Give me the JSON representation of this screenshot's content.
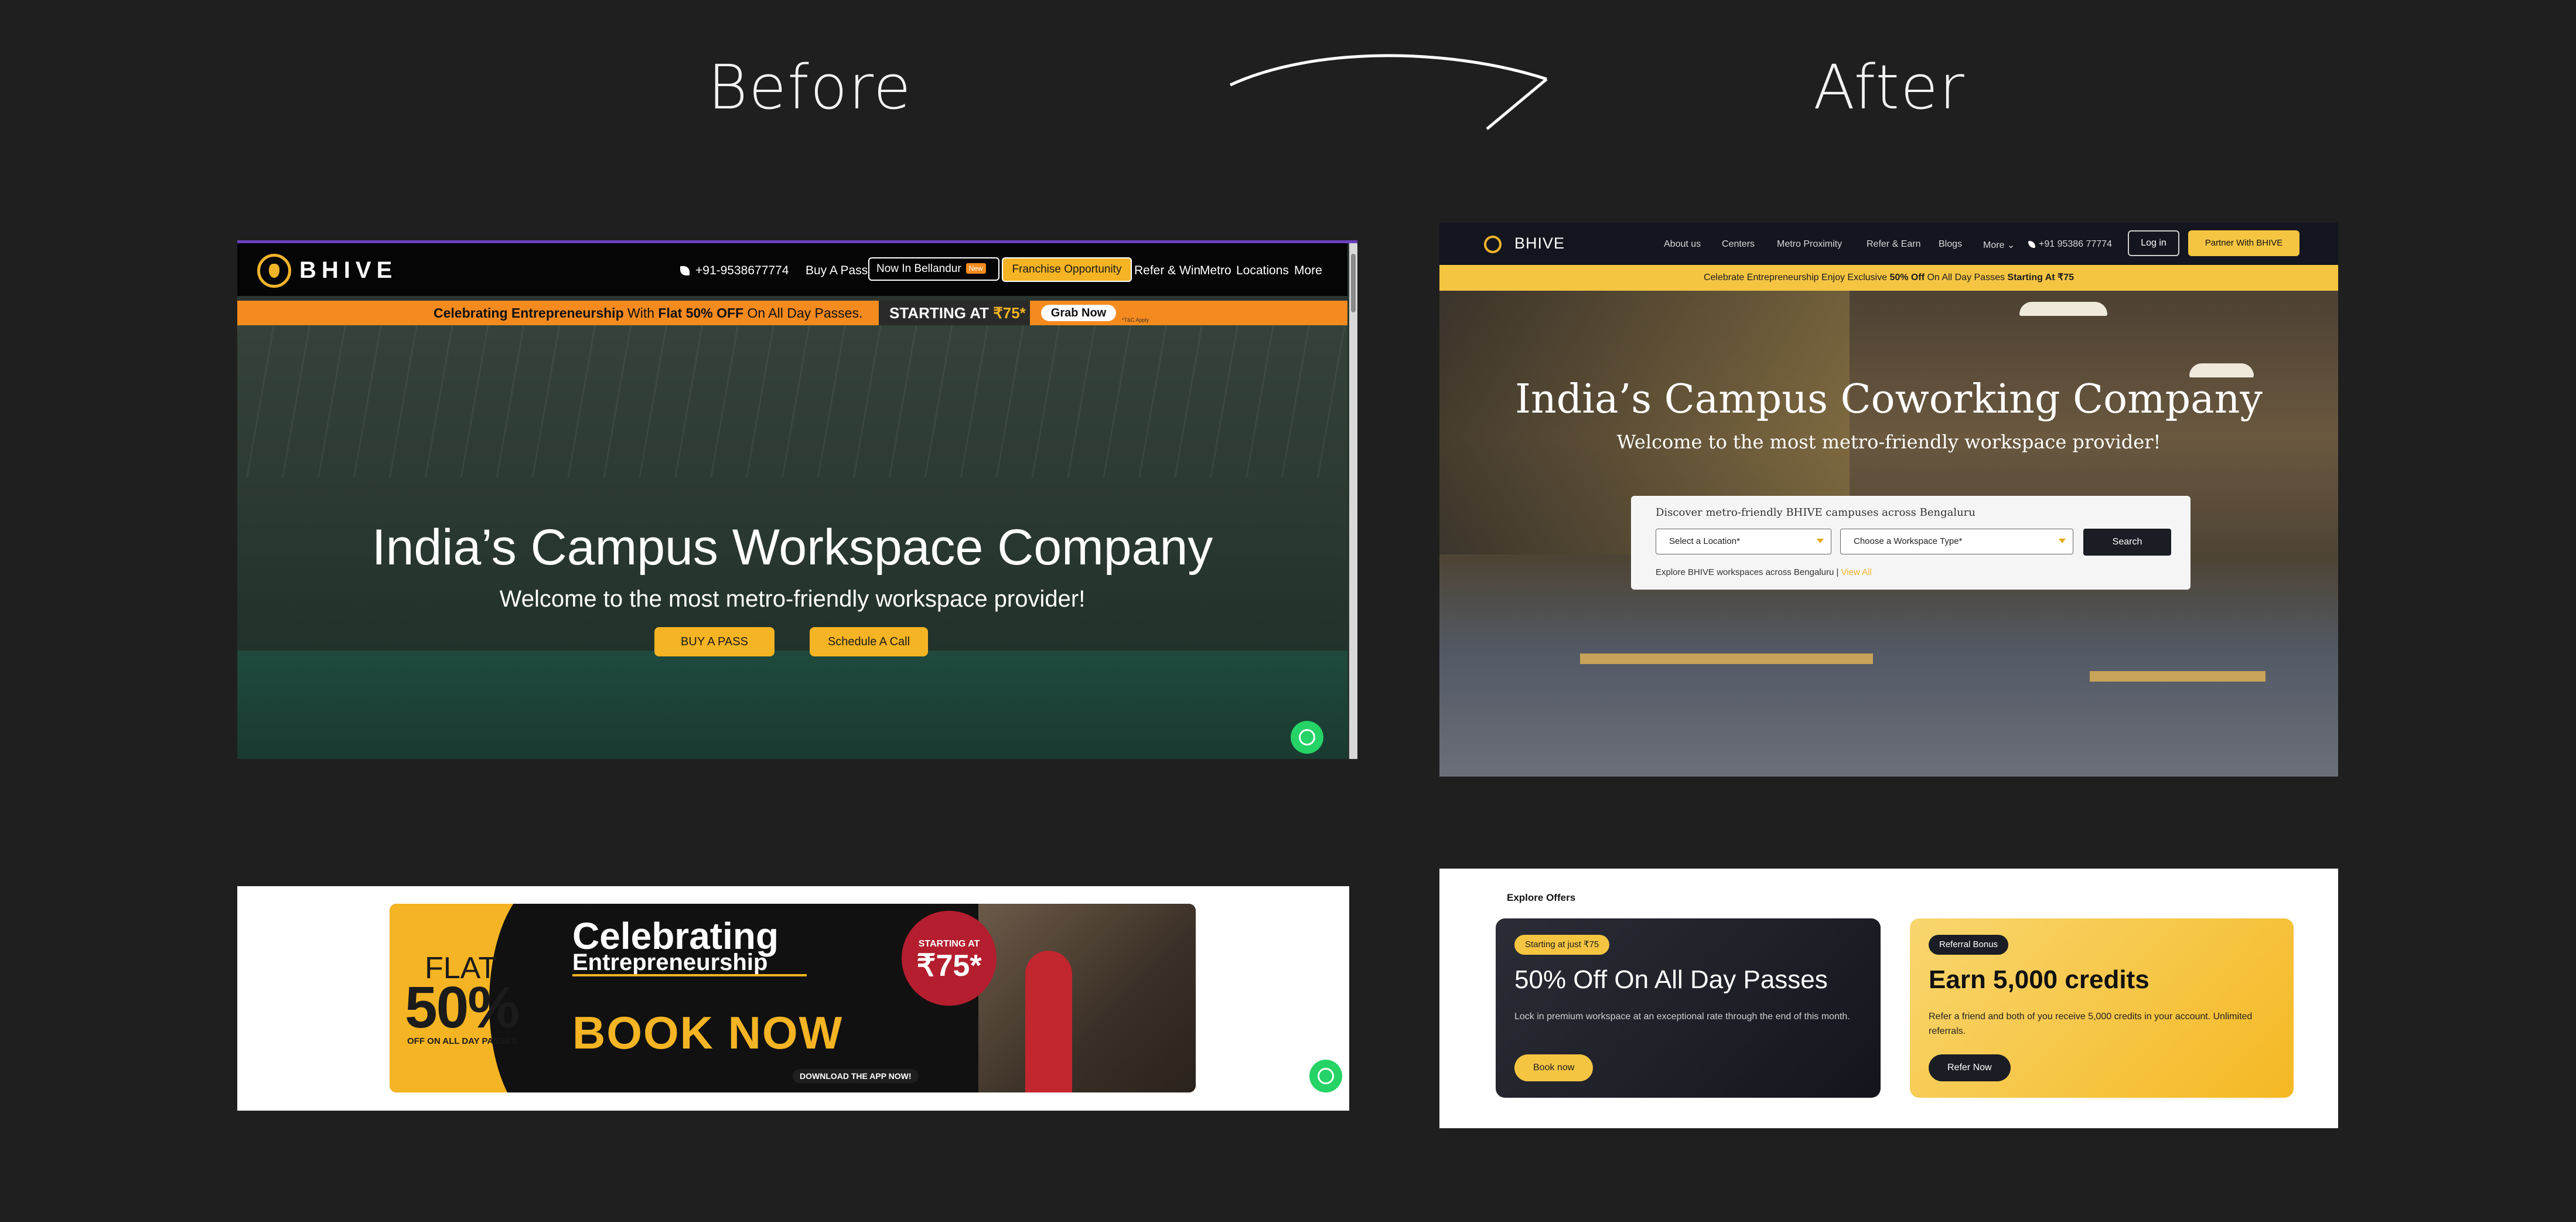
{
  "labels": {
    "before": "Before",
    "after": "After"
  },
  "before_hero": {
    "logo_text": "BHIVE",
    "phone": "+91-9538677774",
    "nav": [
      "Buy A Pass",
      "Refer & Win",
      "Metro",
      "Locations",
      "More"
    ],
    "outline_button": "Now In Bellandur",
    "new_tag": "New",
    "franchise_button": "Franchise Opportunity",
    "banner_text_bold": "Celebrating Entrepreneurship",
    "banner_text_mid": " With ",
    "banner_text_bold2": "Flat 50% OFF",
    "banner_text_end": " On All Day Passes.",
    "banner_price_label": "STARTING AT",
    "banner_price": "₹75*",
    "grab_button": "Grab Now",
    "tnc": "*T&C Apply",
    "title": "India’s Campus Workspace Company",
    "subtitle": "Welcome to the most metro-friendly workspace provider!",
    "cta_primary": "BUY A PASS",
    "cta_secondary": "Schedule A Call"
  },
  "before_banner": {
    "flat": "FLAT",
    "percent": "50%",
    "off_text": "OFF ON ALL DAY PASSES",
    "celebrating": "Celebrating",
    "entrepreneurship": "Entrepreneurship",
    "book_now": "BOOK NOW",
    "download": "DOWNLOAD THE APP NOW!",
    "starting_at": "STARTING AT",
    "price": "₹75*"
  },
  "after_hero": {
    "logo_text": "BHIVE",
    "nav": [
      "About us",
      "Centers",
      "Metro Proximity",
      "Refer & Earn",
      "Blogs",
      "More"
    ],
    "phone": "+91 95386 77774",
    "login": "Log in",
    "partner": "Partner With BHIVE",
    "banner_a": "Celebrate Entrepreneurship Enjoy Exclusive ",
    "banner_b": "50% Off",
    "banner_c": " On All Day Passes ",
    "banner_d": "Starting At ₹75",
    "title": "India’s Campus Coworking Company",
    "subtitle": "Welcome to the most metro-friendly workspace provider!",
    "search_title": "Discover metro-friendly BHIVE campuses across Bengaluru",
    "location_placeholder": "Select a Location*",
    "workspace_placeholder": "Choose a Workspace Type*",
    "search_button": "Search",
    "explore_text": "Explore BHIVE workspaces across Bengaluru | ",
    "view_all": "View All"
  },
  "after_offers": {
    "heading": "Explore Offers",
    "cards": [
      {
        "pill": "Starting at just ₹75",
        "title": "50% Off On All Day Passes",
        "desc": "Lock in premium workspace at an exceptional rate through the end of this month.",
        "button": "Book now"
      },
      {
        "pill": "Referral Bonus",
        "title": "Earn 5,000 credits",
        "desc": "Refer a friend and both of you receive 5,000 credits in your account. Unlimited referrals.",
        "button": "Refer Now"
      }
    ]
  },
  "colors": {
    "accent_yellow": "#f5b423",
    "whatsapp": "#25d366",
    "dark": "#1f1f1f"
  }
}
